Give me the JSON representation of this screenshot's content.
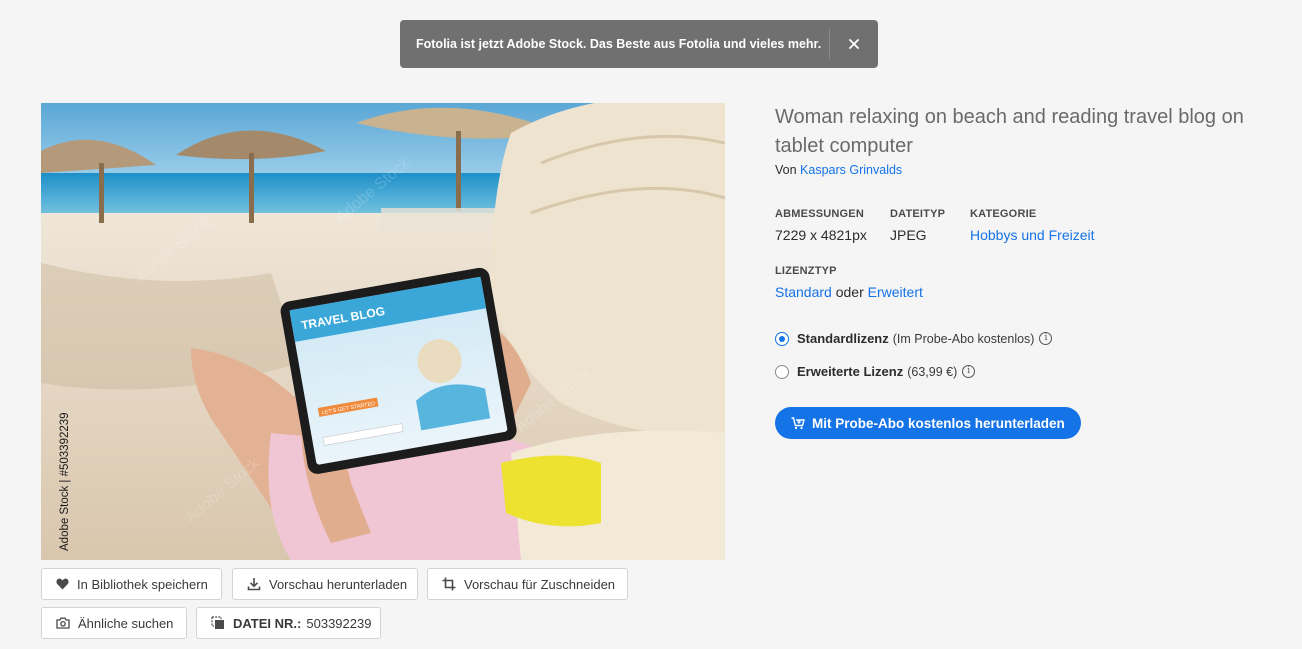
{
  "toast": {
    "message": "Fotolia ist jetzt Adobe Stock. Das Beste aus Fotolia und vieles mehr.",
    "close_glyph": "×"
  },
  "asset": {
    "title": "Woman relaxing on beach and reading travel blog on tablet computer",
    "author_prefix": "Von",
    "author_name": "Kaspars Grinvalds",
    "watermark_id": "Adobe Stock | #503392239",
    "tablet_text": {
      "blog_title": "TRAVEL BLOG",
      "cta": "LET'S GET STARTED"
    }
  },
  "meta": {
    "dimensions_label": "ABMESSUNGEN",
    "dimensions_value": "7229 x 4821px",
    "filetype_label": "DATEITYP",
    "filetype_value": "JPEG",
    "category_label": "KATEGORIE",
    "category_value": "Hobbys und Freizeit",
    "license_type_label": "LIZENZTYP",
    "license_standard": "Standard",
    "license_or": "oder",
    "license_extended": "Erweitert"
  },
  "licenses": [
    {
      "name": "Standardlizenz",
      "note": "(Im Probe-Abo kostenlos)",
      "selected": true
    },
    {
      "name": "Erweiterte Lizenz",
      "note": "(63,99 €)",
      "selected": false
    }
  ],
  "cta": {
    "label": "Mit Probe-Abo kostenlos herunterladen"
  },
  "actions": {
    "save_library": "In Bibliothek speichern",
    "download_preview": "Vorschau herunterladen",
    "crop_preview": "Vorschau für Zuschneiden",
    "find_similar": "Ähnliche suchen",
    "file_no_label": "DATEI NR.:",
    "file_no_value": "503392239"
  },
  "colors": {
    "accent": "#1473e6",
    "toast_bg": "#707070",
    "page_bg": "#f5f5f5"
  }
}
